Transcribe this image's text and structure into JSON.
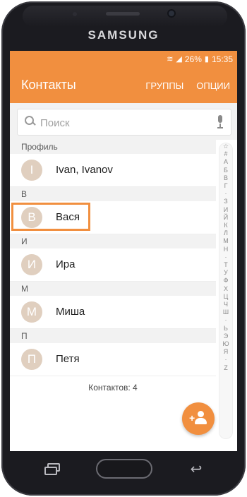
{
  "device": {
    "brand": "SAMSUNG"
  },
  "status_bar": {
    "battery": "26%",
    "time": "15:35"
  },
  "app_bar": {
    "title": "Контакты",
    "actions": [
      "ГРУППЫ",
      "ОПЦИИ"
    ]
  },
  "search": {
    "placeholder": "Поиск",
    "value": ""
  },
  "sections": [
    {
      "header": "Профиль",
      "contacts": [
        {
          "initial": "I",
          "name": "Ivan, Ivanov"
        }
      ]
    },
    {
      "header": "В",
      "contacts": [
        {
          "initial": "В",
          "name": "Вася"
        }
      ]
    },
    {
      "header": "И",
      "contacts": [
        {
          "initial": "И",
          "name": "Ира"
        }
      ]
    },
    {
      "header": "М",
      "contacts": [
        {
          "initial": "М",
          "name": "Миша"
        }
      ]
    },
    {
      "header": "П",
      "contacts": [
        {
          "initial": "П",
          "name": "Петя"
        }
      ]
    }
  ],
  "contact_count": "Контактов: 4",
  "index_letters": [
    "☆",
    "#",
    "А",
    "Б",
    "В",
    "Г",
    "·",
    "З",
    "И",
    "Й",
    "К",
    "Л",
    "М",
    "Н",
    "·",
    "Т",
    "У",
    "Ф",
    "Х",
    "Ц",
    "Ч",
    "Ш",
    "·",
    "Ь",
    "Э",
    "Ю",
    "Я",
    "·",
    "Z"
  ],
  "colors": {
    "accent": "#f18f3f",
    "avatar": "#e0cfbf",
    "section_bg": "#f2f2f2"
  },
  "icons": {
    "search": "search-icon",
    "mic": "mic-icon",
    "add_contact": "add-contact-icon",
    "recent_apps": "recent-apps-icon",
    "home": "home-button",
    "back": "back-icon",
    "wifi": "wifi-icon",
    "signal": "signal-icon",
    "battery": "battery-charging-icon"
  }
}
